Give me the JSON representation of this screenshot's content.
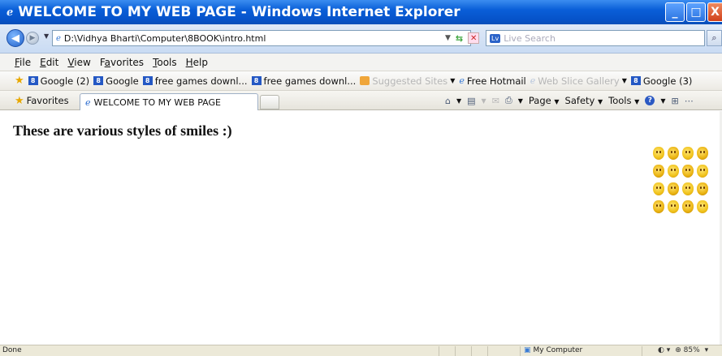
{
  "window": {
    "title": "WELCOME TO MY WEB PAGE - Windows Internet Explorer",
    "buttons": {
      "minimize": "_",
      "maximize": "□",
      "close": "X"
    }
  },
  "address_bar": {
    "url": "D:\\Vidhya Bharti\\Computer\\8BOOK\\intro.html",
    "search_placeholder": "Live Search"
  },
  "menu": [
    "File",
    "Edit",
    "View",
    "Favorites",
    "Tools",
    "Help"
  ],
  "links": [
    {
      "label": "Google (2)",
      "icon": "google-icon",
      "disabled": false
    },
    {
      "label": "Google",
      "icon": "google-icon",
      "disabled": false
    },
    {
      "label": "free games downl...",
      "icon": "google-icon",
      "disabled": false
    },
    {
      "label": "free games downl...",
      "icon": "google-icon",
      "disabled": false
    },
    {
      "label": "Suggested Sites",
      "icon": "suggested-sites-icon",
      "disabled": true,
      "dropdown": true
    },
    {
      "label": "Free Hotmail",
      "icon": "ie-page-icon",
      "disabled": false
    },
    {
      "label": "Web Slice Gallery",
      "icon": "ie-page-icon",
      "disabled": true,
      "dropdown": true
    },
    {
      "label": "Google (3)",
      "icon": "google-icon",
      "disabled": false
    }
  ],
  "tabs": {
    "favorites_label": "Favorites",
    "active_tab": "WELCOME TO MY WEB PAGE"
  },
  "command_bar": {
    "page": "Page",
    "safety": "Safety",
    "tools": "Tools"
  },
  "content": {
    "heading": "These are various styles of smiles :)",
    "smiley_count": 16
  },
  "status": {
    "left": "Done",
    "zone": "My Computer",
    "zoom": "85%"
  },
  "colors": {
    "titlebar": "#0a5fd8",
    "menubar": "#f3f3f1",
    "smiley": "#f0c21a"
  }
}
